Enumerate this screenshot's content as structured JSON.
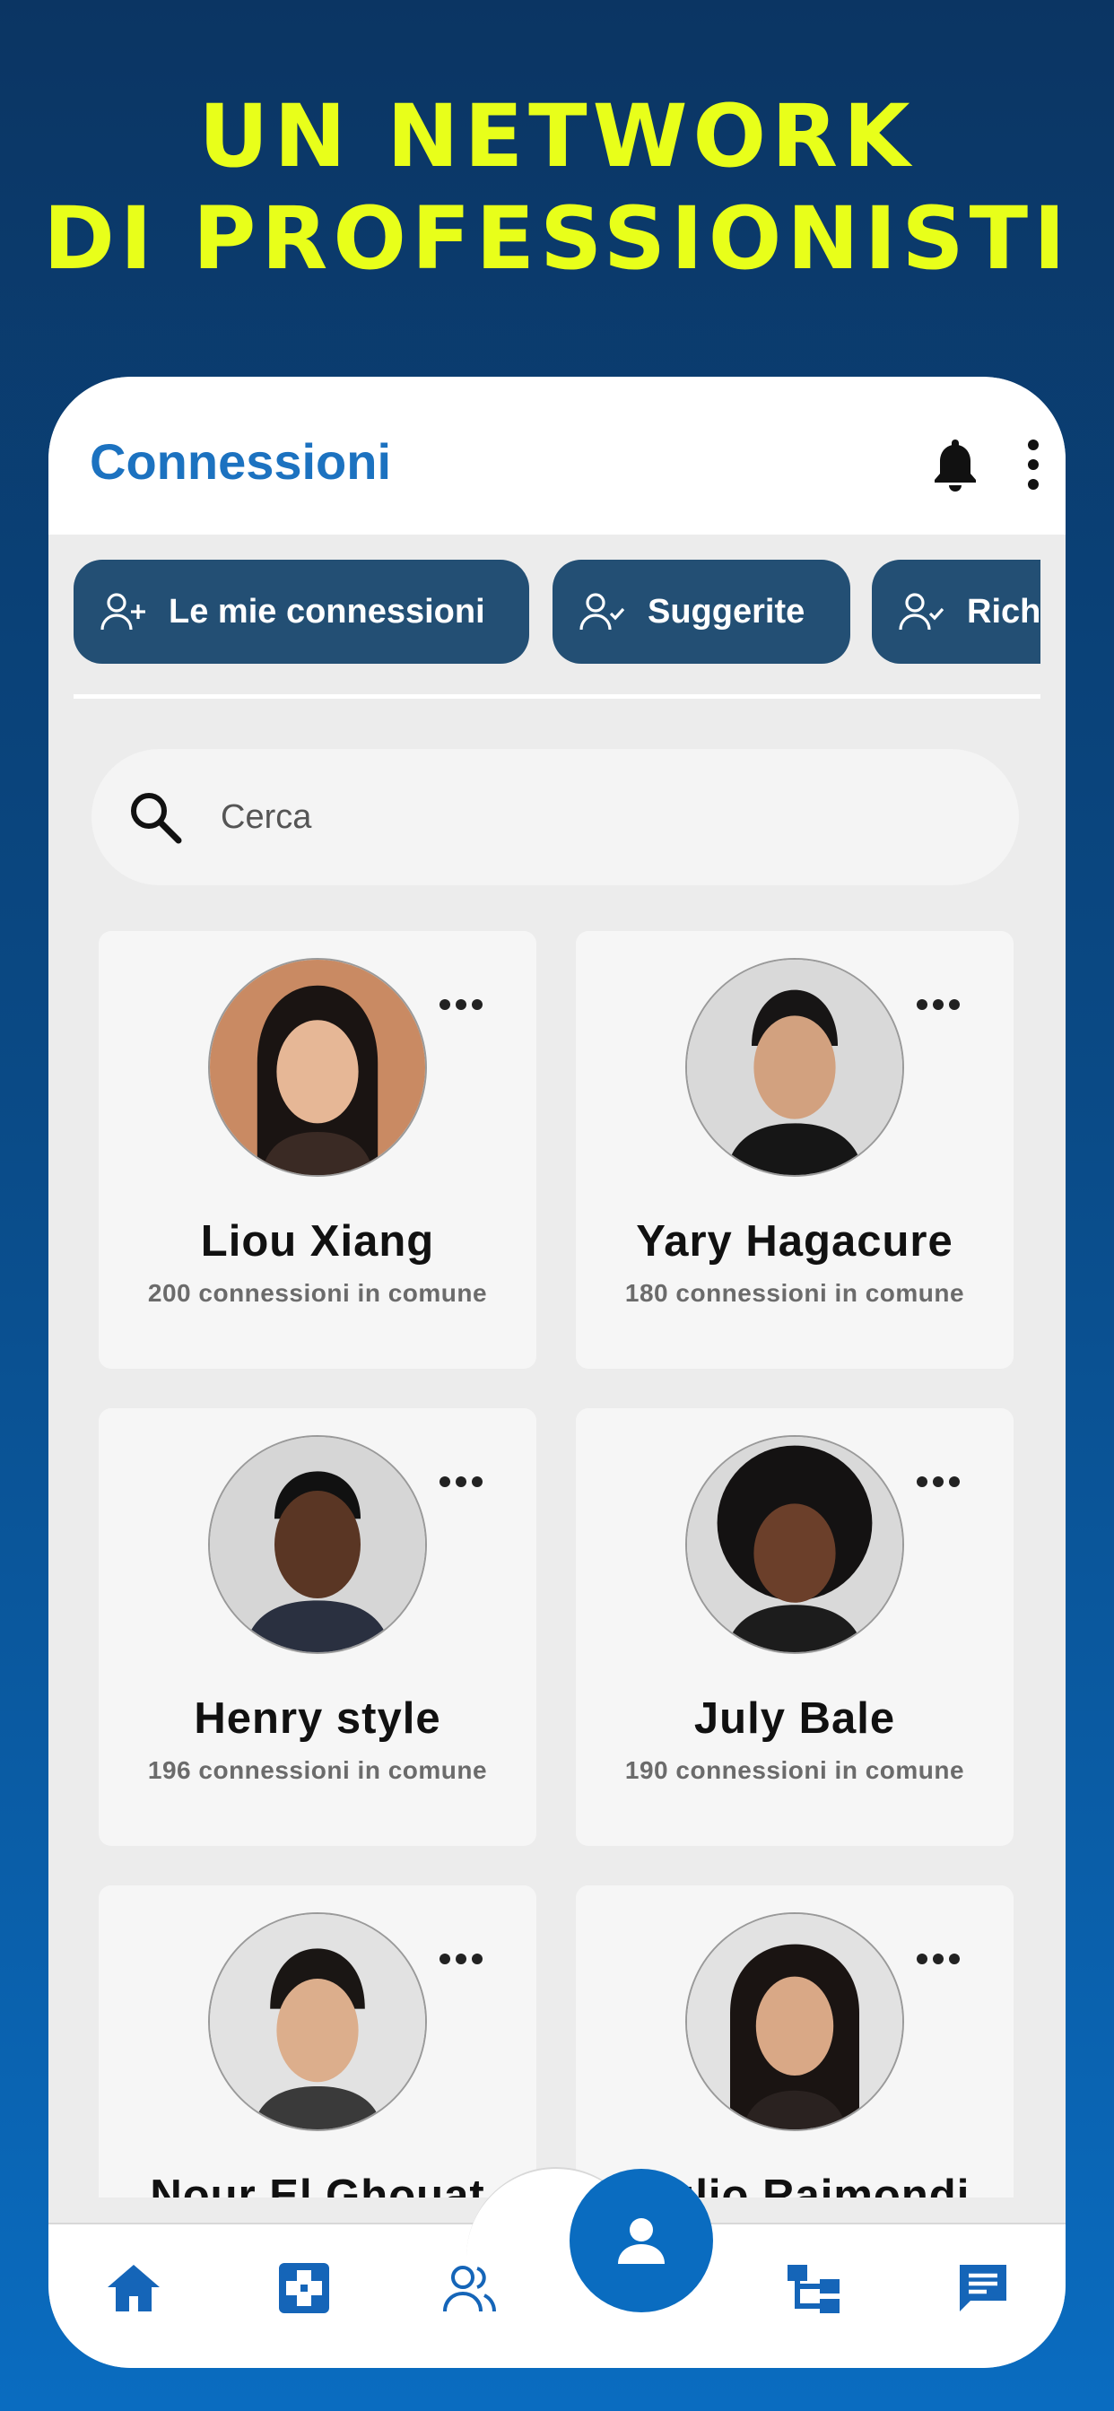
{
  "headline": {
    "line1": "UN NETWORK",
    "line2": "DI PROFESSIONISTI"
  },
  "header": {
    "title": "Connessioni"
  },
  "tabs": [
    {
      "label": "Le mie connessioni",
      "icon": "person-add-icon"
    },
    {
      "label": "Suggerite",
      "icon": "person-check-icon"
    },
    {
      "label": "Rich",
      "icon": "person-check-icon"
    }
  ],
  "search": {
    "placeholder": "Cerca"
  },
  "connections": [
    {
      "name": "Liou Xiang",
      "count": "200",
      "mutual_label": "connessioni in comune",
      "avatar_bg": "#c98a63"
    },
    {
      "name": "Yary Hagacure",
      "count": "180",
      "mutual_label": "connessioni in comune",
      "avatar_bg": "#d9d9d9"
    },
    {
      "name": "Henry style",
      "count": "196",
      "mutual_label": "connessioni in comune",
      "avatar_bg": "#d6d6d6"
    },
    {
      "name": "July Bale",
      "count": "190",
      "mutual_label": "connessioni in comune",
      "avatar_bg": "#d9d9d9"
    },
    {
      "name": "Nour El Ghouat",
      "count": "",
      "mutual_label": "",
      "avatar_bg": "#e2e2e2"
    },
    {
      "name": "Giulio Raimondi",
      "count": "",
      "mutual_label": "",
      "avatar_bg": "#e2e2e2"
    }
  ],
  "nav": [
    {
      "name": "home",
      "icon": "home-icon"
    },
    {
      "name": "medical",
      "icon": "medical-cross-icon"
    },
    {
      "name": "network",
      "icon": "people-icon"
    },
    {
      "name": "profile",
      "icon": "person-icon"
    },
    {
      "name": "hierarchy",
      "icon": "hierarchy-icon"
    },
    {
      "name": "messages",
      "icon": "chat-icon"
    }
  ],
  "colors": {
    "headline": "#e8ff1a",
    "accent": "#1c72c0",
    "tab_bg": "#234f74",
    "nav_icon": "#1565b8"
  }
}
